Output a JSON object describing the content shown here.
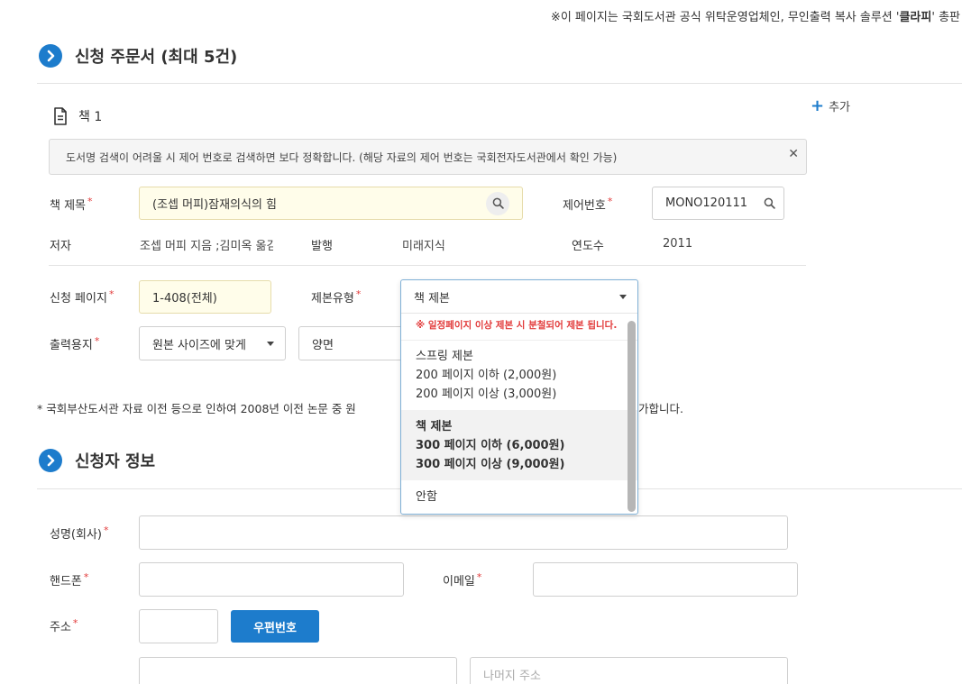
{
  "notice": {
    "prefix": "※이 페이지는 국회도서관 공식 위탁운영업체인, 무인출력 복사 솔루션 '",
    "brand": "클라피",
    "suffix": "' 총판"
  },
  "order_section": {
    "title": "신청 주문서 (최대 5건)",
    "add_label": "추가",
    "book_label": "책 1",
    "info_text": "도서명 검색이 어려울 시 제어 번호로 검색하면 보다 정확합니다. (해당 자료의 제어 번호는 국회전자도서관에서 확인 가능)",
    "title_label": "책 제목",
    "title_value": "(조셉 머피)잠재의식의 힘",
    "control_label": "제어번호",
    "control_value": "MONO120111",
    "author_label": "저자",
    "author_value": "조셉 머피 지음 ;김미옥 옮김",
    "publisher_label": "발행",
    "publisher_value": "미래지식",
    "year_label": "연도수",
    "year_value": "2011",
    "pages_label": "신청 페이지",
    "pages_value": "1-408(전체)",
    "binding_label": "제본유형",
    "binding_value": "책 제본",
    "paper_label": "출력용지",
    "paper_value": "원본 사이즈에 맞게",
    "duplex_value": "양면",
    "footnote_left": "* 국회부산도서관 자료 이전 등으로 인하여 2008년 이전 논문 중 원",
    "footnote_right": "가합니다."
  },
  "binding_dropdown": {
    "selected": "책 제본",
    "warning": "※ 일정페이지 이상 제본 시 분철되어 제본 됩니다.",
    "options": [
      {
        "lines": [
          "스프링 제본",
          "200 페이지 이하 (2,000원)",
          "200 페이지 이상 (3,000원)"
        ]
      },
      {
        "lines": [
          "책 제본",
          "300 페이지 이하 (6,000원)",
          "300 페이지 이상 (9,000원)"
        ]
      },
      {
        "lines": [
          "안함"
        ]
      }
    ]
  },
  "applicant_section": {
    "title": "신청자 정보",
    "name_label": "성명(회사)",
    "phone_label": "핸드폰",
    "email_label": "이메일",
    "address_label": "주소",
    "zip_button": "우편번호",
    "address_rest_placeholder": "나머지 주소"
  },
  "colors": {
    "accent": "#1d7ccc",
    "required": "#e23b3b",
    "highlight_input": "#fffdea"
  },
  "icons": [
    "chevron-right-icon",
    "document-icon",
    "plus-icon",
    "close-icon",
    "search-icon",
    "caret-down-icon"
  ]
}
